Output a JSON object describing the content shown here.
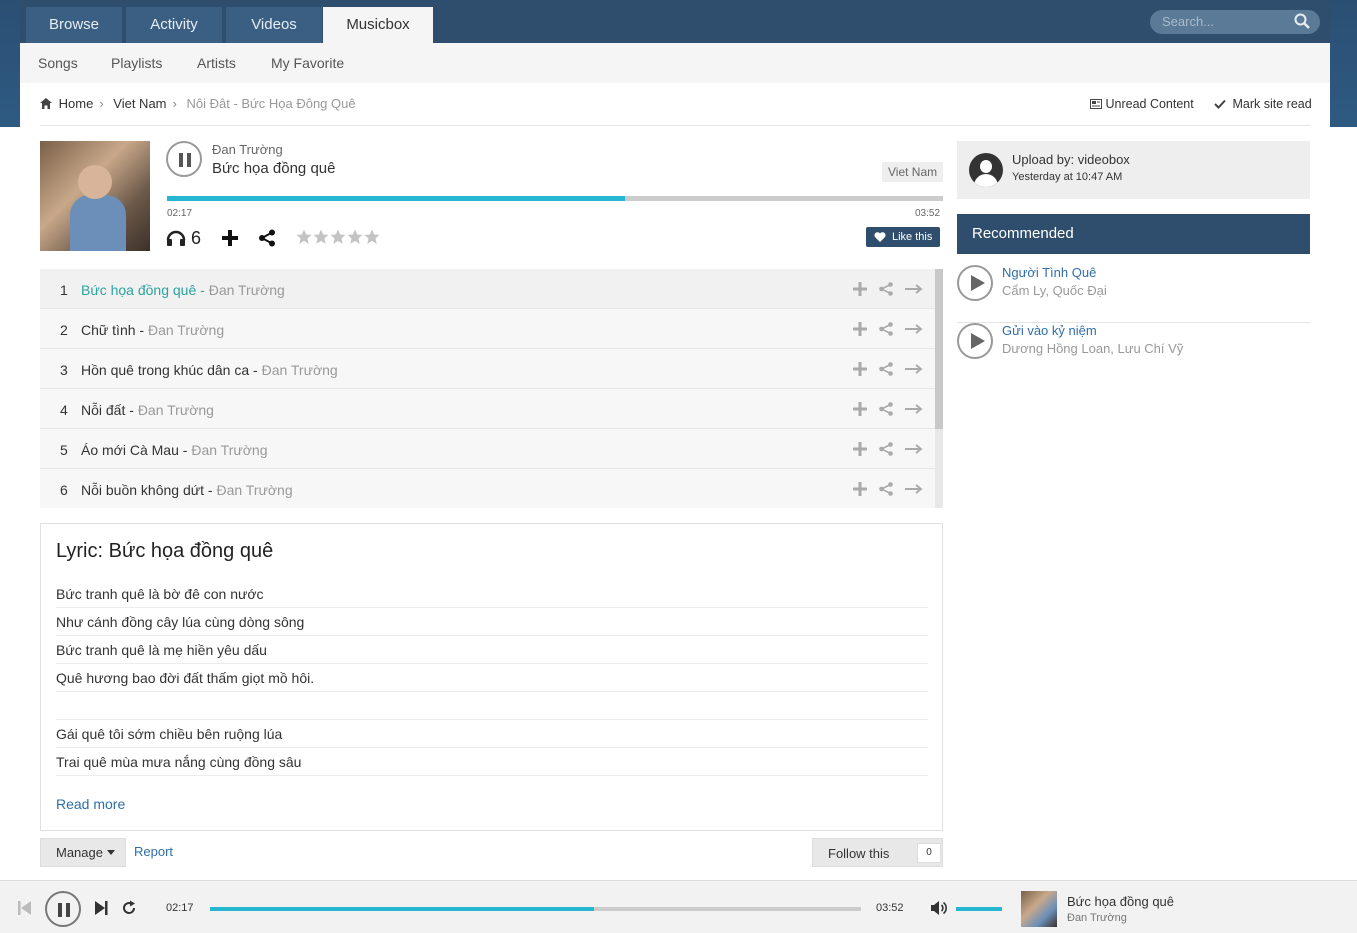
{
  "nav": {
    "tabs": [
      "Browse",
      "Activity",
      "Videos",
      "Musicbox"
    ],
    "active_tab": "Musicbox",
    "search_placeholder": "Search..."
  },
  "subnav": [
    "Songs",
    "Playlists",
    "Artists",
    "My Favorite"
  ],
  "breadcrumb": [
    "Home",
    "Viet Nam",
    "Nôi Đât - Bức Họa Đông Quê"
  ],
  "top_actions": {
    "unread": "Unread Content",
    "mark_read": "Mark site read"
  },
  "song": {
    "artist": "Đan Trường",
    "title": "Bức họa đồng quê",
    "genre": "Viet Nam",
    "current_time": "02:17",
    "total_time": "03:52",
    "progress_fraction": 0.59,
    "listens": "6",
    "rating": 0,
    "like_label": "Like this"
  },
  "tracks": [
    {
      "num": "1",
      "title": "Bức họa đồng quê",
      "artist": "Đan Trường"
    },
    {
      "num": "2",
      "title": "Chữ tình",
      "artist": "Đan Trường"
    },
    {
      "num": "3",
      "title": "Hồn quê trong khúc dân ca",
      "artist": "Đan Trường"
    },
    {
      "num": "4",
      "title": "Nỗi đất",
      "artist": "Đan Trường"
    },
    {
      "num": "5",
      "title": "Áo mới Cà Mau",
      "artist": "Đan Trường"
    },
    {
      "num": "6",
      "title": "Nỗi buồn không dứt",
      "artist": "Đan Trường"
    }
  ],
  "lyric": {
    "title": "Lyric: Bức họa đồng quê",
    "lines": [
      "Bức tranh quê là bờ đê con nước",
      "Như cánh đồng cây lúa cùng dòng sông",
      "Bức tranh quê là mẹ hiền yêu dấu",
      "Quê hương bao đời đất thấm giọt mồ hôi.",
      "",
      "Gái quê tôi sớm chiều bên ruộng lúa",
      "Trai quê mùa mưa nắng cùng đồng sâu"
    ],
    "read_more": "Read more"
  },
  "footer_actions": {
    "manage": "Manage",
    "report": "Report",
    "follow": "Follow this",
    "follow_count": "0"
  },
  "uploader": {
    "by": "Upload by: videobox",
    "when": "Yesterday at 10:47 AM"
  },
  "recommended": {
    "heading": "Recommended",
    "items": [
      {
        "title": "Người Tình Quê",
        "artists": "Cẩm Ly, Quốc Đại"
      },
      {
        "title": "Gửi vào kỷ niệm",
        "artists": "Dương Hồng Loan, Lưu Chí Vỹ"
      }
    ]
  },
  "player": {
    "current_time": "02:17",
    "total_time": "03:52",
    "progress_fraction": 0.59,
    "volume_fraction": 1.0,
    "title": "Bức họa đồng quê",
    "artist": "Đan Trường"
  },
  "colors": {
    "accent": "#27b6d2",
    "nav": "#2f4d6c",
    "link": "#2f6ea8",
    "active_track": "#2aa4a0"
  }
}
